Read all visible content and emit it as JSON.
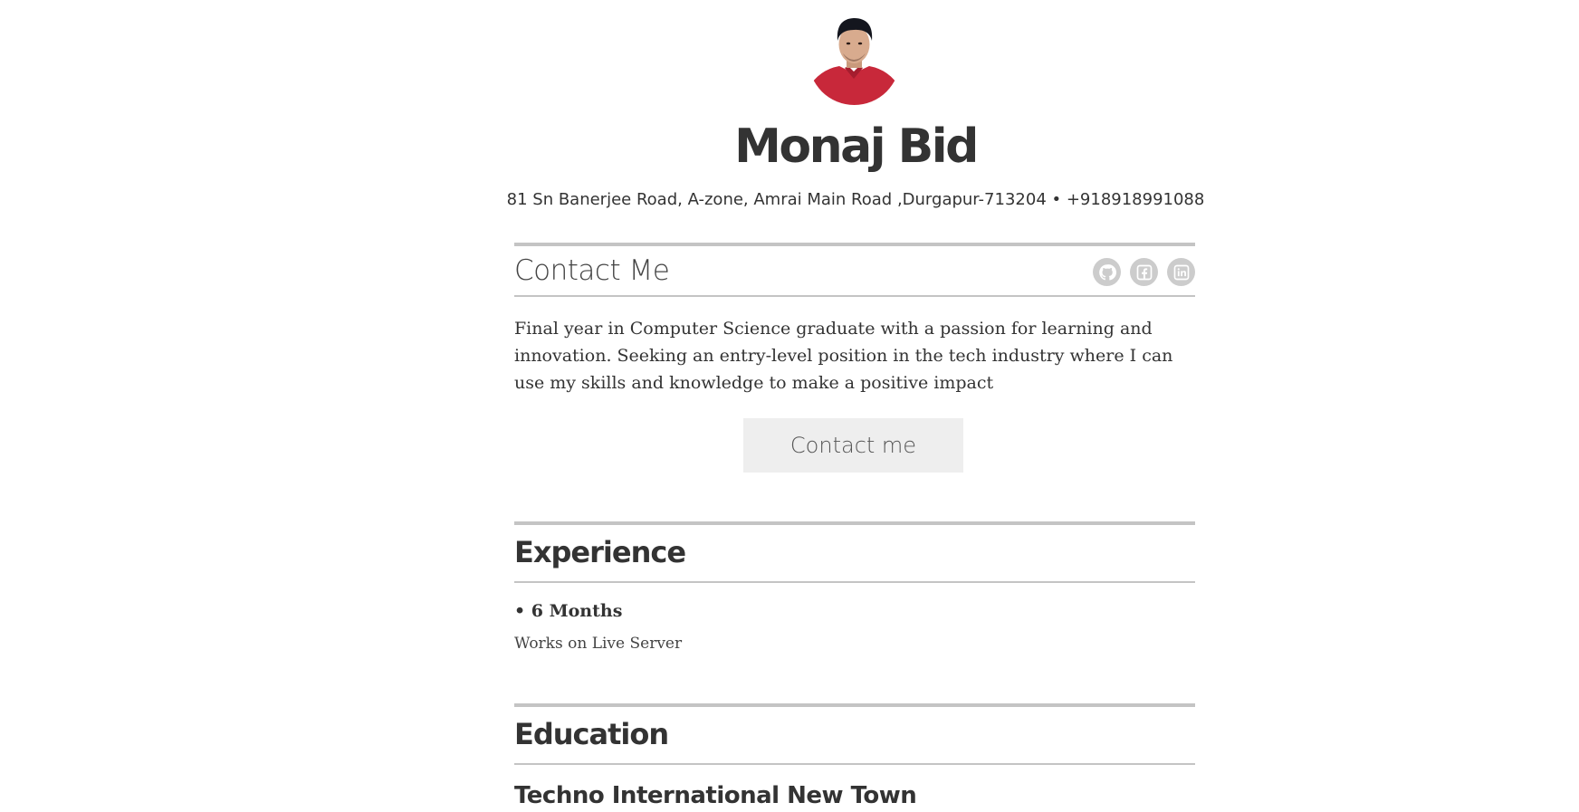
{
  "profile": {
    "name": "Monaj Bid",
    "address_line": "81 Sn Banerjee Road, A-zone, Amrai Main Road ,Durgapur-713204 • +918918991088"
  },
  "contact": {
    "title": "Contact Me",
    "socials": [
      {
        "icon": "github-icon"
      },
      {
        "icon": "facebook-icon"
      },
      {
        "icon": "linkedin-icon"
      }
    ],
    "summary": "Final year in Computer Science graduate with a passion for learning and innovation. Seeking an entry-level position in the tech industry where I can use my skills and knowledge to make a positive impact",
    "button_label": "Contact me"
  },
  "experience": {
    "title": "Experience",
    "items": [
      {
        "title": "• 6 Months",
        "description": "Works on Live Server"
      }
    ]
  },
  "education": {
    "title": "Education",
    "items": [
      {
        "title": "Techno International New Town"
      }
    ]
  },
  "colors": {
    "text": "#333333",
    "rule": "#c4c4c4",
    "button_bg": "#eeeeee",
    "social_bg": "#cccccc",
    "avatar_shirt": "#c8283a"
  }
}
